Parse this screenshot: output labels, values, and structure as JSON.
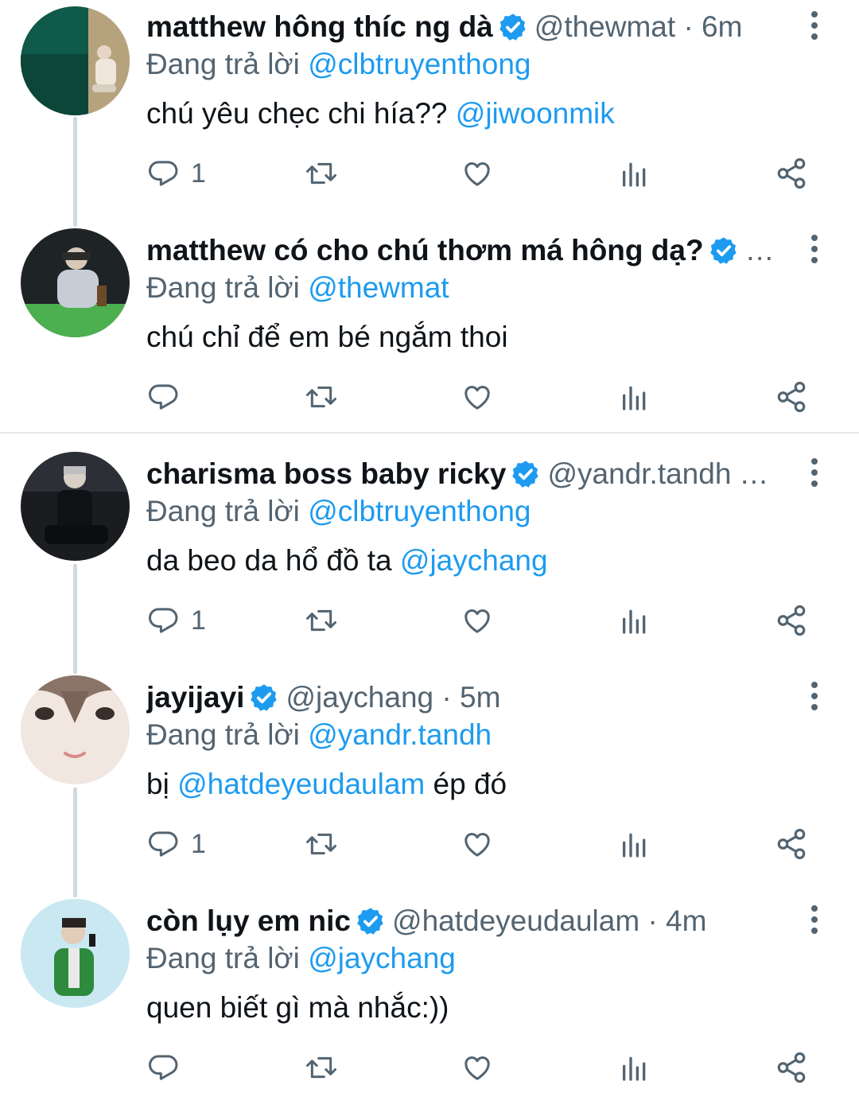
{
  "reply_prefix": "Đang trả lời",
  "colors": {
    "link": "#1d9bf0",
    "verified": "#1d9bf0",
    "muted": "#536471",
    "divider": "#e4e8ea"
  },
  "tweets": [
    {
      "name": "matthew hông thíc ng dà",
      "handle": "@thewmat · 6m",
      "handle_truncated": false,
      "name_ellipsis": "",
      "reply_to": "@clbtruyenthong",
      "text_before": "chú yêu chẹc chi hía?? ",
      "mention": "@jiwoonmik",
      "text_after": "",
      "reply_count": "1",
      "avatar_desc": "green-pond-avatar"
    },
    {
      "name": "matthew có cho chú thơm má hông dạ?",
      "handle": "",
      "handle_truncated": false,
      "name_ellipsis": "…",
      "reply_to": "@thewmat",
      "text_before": "chú chỉ để em bé ngắm thoi",
      "mention": "",
      "text_after": "",
      "reply_count": "",
      "avatar_desc": "night-park-avatar"
    },
    {
      "name": "charisma boss baby ricky",
      "handle": "@yandr.tandh",
      "handle_truncated": true,
      "name_ellipsis": "…",
      "reply_to": "@clbtruyenthong",
      "text_before": "da beo da hổ đồ ta ",
      "mention": "@jaychang",
      "text_after": "",
      "reply_count": "1",
      "avatar_desc": "dark-portrait-avatar"
    },
    {
      "name": "jayijayi",
      "handle": "@jaychang · 5m",
      "handle_truncated": false,
      "name_ellipsis": "",
      "reply_to": "@yandr.tandh",
      "text_before": "bị ",
      "mention": "@hatdeyeudaulam",
      "text_after": " ép đó",
      "reply_count": "1",
      "avatar_desc": "face-closeup-avatar"
    },
    {
      "name": "còn lụy em nic",
      "handle": "@hatdeyeudaulam · 4m",
      "handle_truncated": false,
      "name_ellipsis": "",
      "reply_to": "@jaychang",
      "text_before": "quen biết gì mà nhắc:))",
      "mention": "",
      "text_after": "",
      "reply_count": "",
      "avatar_desc": "light-curtain-avatar"
    }
  ]
}
